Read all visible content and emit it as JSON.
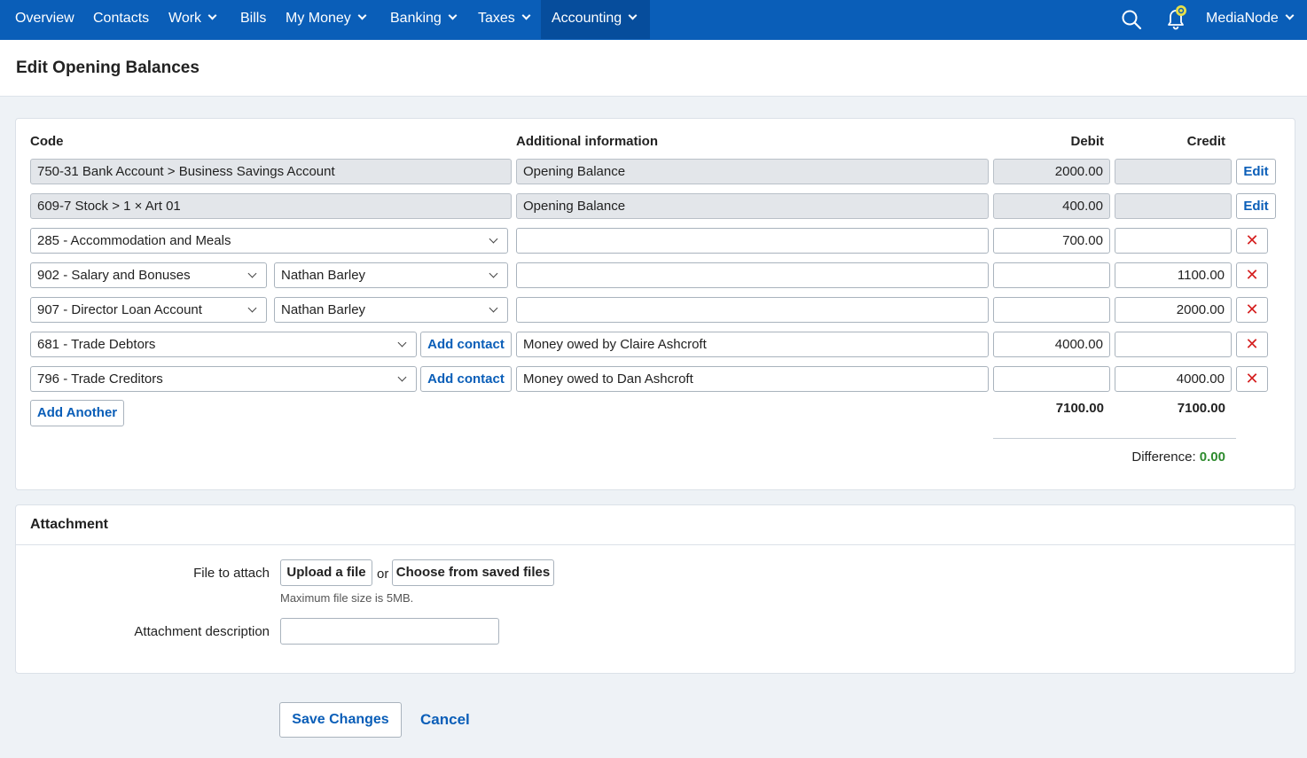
{
  "nav": {
    "items": [
      {
        "label": "Overview",
        "has_menu": false
      },
      {
        "label": "Contacts",
        "has_menu": false
      },
      {
        "label": "Work",
        "has_menu": true
      },
      {
        "label": "Bills",
        "has_menu": false
      },
      {
        "label": "My Money",
        "has_menu": true
      },
      {
        "label": "Banking",
        "has_menu": true
      },
      {
        "label": "Taxes",
        "has_menu": true
      },
      {
        "label": "Accounting",
        "has_menu": true,
        "active": true
      }
    ],
    "org_name": "MediaNode"
  },
  "page": {
    "title": "Edit Opening Balances"
  },
  "table": {
    "headers": {
      "code": "Code",
      "info": "Additional information",
      "debit": "Debit",
      "credit": "Credit"
    },
    "rows": [
      {
        "code": "750-31 Bank Account  >  Business Savings Account",
        "info": "Opening Balance",
        "debit": "2000.00",
        "credit": "",
        "action": "Edit"
      },
      {
        "code": "609-7 Stock  >  1 × Art 01",
        "info": "Opening Balance",
        "debit": "400.00",
        "credit": "",
        "action": "Edit"
      },
      {
        "code": "285 - Accommodation and Meals",
        "info": "",
        "debit": "700.00",
        "credit": "",
        "action": "✕"
      },
      {
        "code": "902 - Salary and Bonuses",
        "contact": "Nathan Barley",
        "info": "",
        "debit": "",
        "credit": "1100.00",
        "action": "✕"
      },
      {
        "code": "907 - Director Loan Account",
        "contact": "Nathan Barley",
        "info": "",
        "debit": "",
        "credit": "2000.00",
        "action": "✕"
      },
      {
        "code": "681 - Trade Debtors",
        "add_contact": "Add contact",
        "info": "Money owed by Claire Ashcroft",
        "debit": "4000.00",
        "credit": "",
        "action": "✕"
      },
      {
        "code": "796 - Trade Creditors",
        "add_contact": "Add contact",
        "info": "Money owed to Dan Ashcroft",
        "debit": "",
        "credit": "4000.00",
        "action": "✕"
      }
    ],
    "add_another": "Add Another",
    "total_debit": "7100.00",
    "total_credit": "7100.00",
    "difference_label": "Difference:",
    "difference_value": "0.00",
    "difference_color": "#2e8b2e"
  },
  "attachment": {
    "title": "Attachment",
    "file_label": "File to attach",
    "upload_label": "Upload a file",
    "or_text": "or",
    "choose_label": "Choose from saved files",
    "max_size_note": "Maximum file size is 5MB.",
    "description_label": "Attachment description",
    "description_value": ""
  },
  "actions": {
    "save": "Save Changes",
    "cancel": "Cancel"
  },
  "colors": {
    "nav_bg": "#0a5eb8",
    "nav_active": "#064d9c",
    "link": "#0a5eb8",
    "delete": "#d52020",
    "notification_dot": "#e6e04a"
  }
}
